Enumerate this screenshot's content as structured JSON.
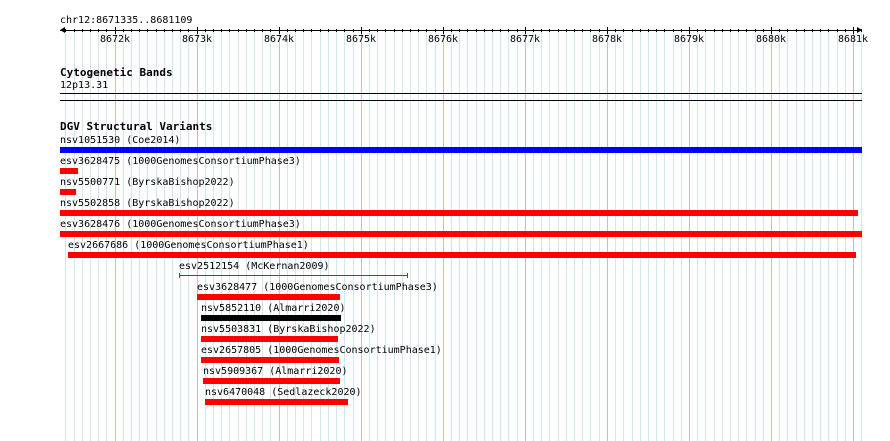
{
  "location": "chr12:8671335..8681109",
  "ruler": {
    "ticks": [
      "8672k",
      "8673k",
      "8674k",
      "8675k",
      "8676k",
      "8677k",
      "8678k",
      "8679k",
      "8680k",
      "8681k"
    ]
  },
  "cytoband": {
    "title": "Cytogenetic Bands",
    "band": "12p13.31"
  },
  "dgv": {
    "title": "DGV Structural Variants",
    "features": [
      {
        "id": "nsv1051530",
        "source": "(Coe2014)",
        "color": "#0000ff",
        "style": "bar",
        "start": 8671335,
        "end": 8681109
      },
      {
        "id": "esv3628475",
        "source": "(1000GenomesConsortiumPhase3)",
        "color": "#ff0000",
        "style": "bar",
        "start": 8671335,
        "end": 8671560
      },
      {
        "id": "nsv5500771",
        "source": "(ByrskaBishop2022)",
        "color": "#ff0000",
        "style": "bar",
        "start": 8671335,
        "end": 8671530
      },
      {
        "id": "nsv5502858",
        "source": "(ByrskaBishop2022)",
        "color": "#ff0000",
        "style": "bar",
        "start": 8671335,
        "end": 8681060
      },
      {
        "id": "esv3628476",
        "source": "(1000GenomesConsortiumPhase3)",
        "color": "#ff0000",
        "style": "bar",
        "start": 8671335,
        "end": 8681109
      },
      {
        "id": "esv2667686",
        "source": "(1000GenomesConsortiumPhase1)",
        "color": "#ff0000",
        "style": "bar",
        "start": 8671430,
        "end": 8681030
      },
      {
        "id": "esv2512154",
        "source": "(McKernan2009)",
        "color": "#ff0000",
        "style": "line",
        "start": 8672780,
        "end": 8675560
      },
      {
        "id": "esv3628477",
        "source": "(1000GenomesConsortiumPhase3)",
        "color": "#ff0000",
        "style": "bar",
        "start": 8673010,
        "end": 8674750
      },
      {
        "id": "nsv5852110",
        "source": "(Almarri2020)",
        "color": "#000000",
        "style": "bar",
        "start": 8673050,
        "end": 8674760
      },
      {
        "id": "nsv5503831",
        "source": "(ByrskaBishop2022)",
        "color": "#ff0000",
        "style": "bar",
        "start": 8673050,
        "end": 8674720
      },
      {
        "id": "esv2657805",
        "source": "(1000GenomesConsortiumPhase1)",
        "color": "#ff0000",
        "style": "bar",
        "start": 8673050,
        "end": 8674740
      },
      {
        "id": "nsv5909367",
        "source": "(Almarri2020)",
        "color": "#ff0000",
        "style": "bar",
        "start": 8673080,
        "end": 8674750
      },
      {
        "id": "nsv6470048",
        "source": "(Sedlazeck2020)",
        "color": "#ff0000",
        "style": "bar",
        "start": 8673100,
        "end": 8674840
      }
    ]
  },
  "colors": {
    "grid_minor": "#cfe7ef",
    "grid_major": "#9ccfe0",
    "text": "#000000"
  }
}
